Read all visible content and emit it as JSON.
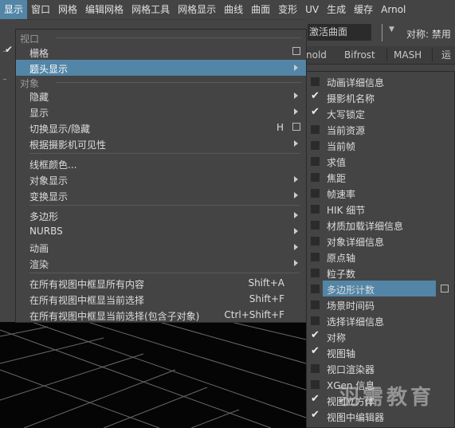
{
  "menubar": {
    "items": [
      "显示",
      "窗口",
      "网格",
      "编辑网格",
      "网格工具",
      "网格显示",
      "曲线",
      "曲面",
      "变形",
      "UV",
      "生成",
      "缓存",
      "Arnol"
    ],
    "active_index": 0
  },
  "toolbar": {
    "field_value": "激活曲面",
    "symmetry": "对称: 禁用"
  },
  "shelf_tabs": [
    "nold",
    "Bifrost",
    "MASH",
    "运"
  ],
  "menu": {
    "viewport_header": "视口",
    "grid": "栅格",
    "heads_up_display": "题头显示",
    "object_header": "对象",
    "hide": "隐藏",
    "show": "显示",
    "toggle_show_hide": "切换显示/隐藏",
    "toggle_hotkey": "H",
    "camera_visibility": "根据摄影机可见性",
    "wireframe_color": "线框颜色...",
    "object_display": "对象显示",
    "transform_display": "变换显示",
    "polygons": "多边形",
    "nurbs": "NURBS",
    "animation": "动画",
    "rendering": "渲染",
    "frame_all": "在所有视图中框显所有内容",
    "frame_all_shortcut": "Shift+A",
    "frame_selection": "在所有视图中框显当前选择",
    "frame_selection_shortcut": "Shift+F",
    "frame_selection_children": "在所有视图中框显当前选择(包含子对象)",
    "frame_selection_children_shortcut": "Ctrl+Shift+F"
  },
  "submenu": {
    "items": [
      {
        "label": "动画详细信息",
        "checked": false
      },
      {
        "label": "摄影机名称",
        "checked": true
      },
      {
        "label": "大写锁定",
        "checked": true
      },
      {
        "label": "当前资源",
        "checked": false
      },
      {
        "label": "当前帧",
        "checked": false
      },
      {
        "label": "求值",
        "checked": false
      },
      {
        "label": "焦距",
        "checked": false
      },
      {
        "label": "帧速率",
        "checked": false
      },
      {
        "label": "HIK 细节",
        "checked": false
      },
      {
        "label": "材质加载详细信息",
        "checked": false
      },
      {
        "label": "对象详细信息",
        "checked": false
      },
      {
        "label": "原点轴",
        "checked": false
      },
      {
        "label": "粒子数",
        "checked": false
      },
      {
        "label": "多边形计数",
        "checked": false,
        "highlighted": true,
        "option_box": true
      },
      {
        "label": "场景时间码",
        "checked": false
      },
      {
        "label": "选择详细信息",
        "checked": false
      },
      {
        "label": "对称",
        "checked": true
      },
      {
        "label": "视图轴",
        "checked": true
      },
      {
        "label": "视口渲染器",
        "checked": false
      },
      {
        "label": "XGen 信息",
        "checked": false
      },
      {
        "label": "视图立方体",
        "checked": true
      },
      {
        "label": "视图中编辑器",
        "checked": true
      }
    ]
  },
  "watermark": "羽需教育",
  "colors": {
    "highlight": "#5285a6",
    "menu_bg": "#444444",
    "viewport_bg": "#050505"
  }
}
